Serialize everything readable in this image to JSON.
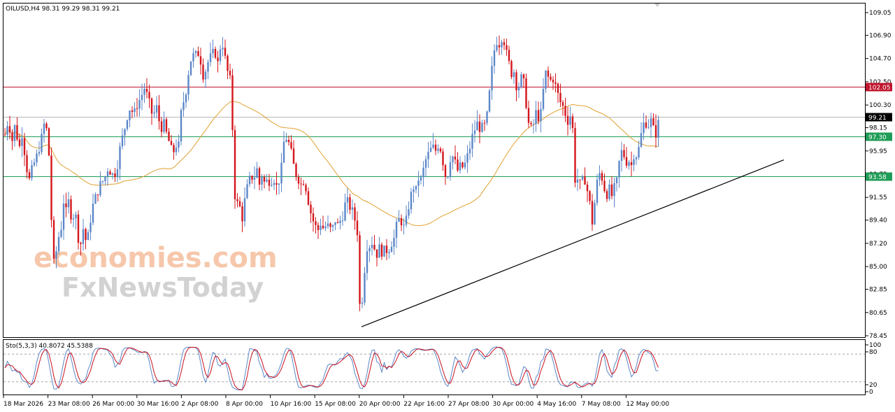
{
  "chart_data": {
    "type": "candlestick",
    "header": "OILUSD,H4  98.31 99.29 98.31 99.21",
    "oscillator_label": "Sto(5,3,3) 40.8072 45.5388",
    "price_ticks": [
      "109.05",
      "106.90",
      "104.70",
      "102.50",
      "100.30",
      "98.15",
      "95.95",
      "93.75",
      "91.55",
      "89.40",
      "87.20",
      "85.00",
      "82.85",
      "80.65",
      "78.45"
    ],
    "price_range": [
      78.45,
      109.05
    ],
    "oscillator_ticks": [
      "100",
      "80",
      "20",
      "0"
    ],
    "oscillator_levels": [
      80,
      20
    ],
    "time_labels": [
      "18 Mar 2026",
      "23 Mar 08:00",
      "26 Mar 00:00",
      "30 Mar 16:00",
      "2 Apr 08:00",
      "8 Apr 00:00",
      "10 Apr 16:00",
      "15 Apr 08:00",
      "20 Apr 00:00",
      "22 Apr 16:00",
      "27 Apr 08:00",
      "30 Apr 00:00",
      "4 May 16:00",
      "7 May 08:00",
      "12 May 00:00"
    ],
    "levels": [
      {
        "value": 102.05,
        "label": "102.05",
        "color": "#c0142c"
      },
      {
        "value": 99.21,
        "label": "99.21",
        "color": "#000000"
      },
      {
        "value": 97.3,
        "label": "97.30",
        "color": "#1f9c57"
      },
      {
        "value": 93.58,
        "label": "93.58",
        "color": "#1f9c57"
      }
    ],
    "trendline": {
      "from": [
        110,
        79.3
      ],
      "to": [
        1080,
        95.1
      ],
      "color": "#000000"
    },
    "close_path": [
      [
        0,
        97.5
      ],
      [
        5,
        99.0
      ],
      [
        10,
        96.8
      ],
      [
        15,
        98.6
      ],
      [
        20,
        96.0
      ],
      [
        25,
        97.8
      ],
      [
        30,
        94.7
      ],
      [
        35,
        93.2
      ],
      [
        40,
        94.5
      ],
      [
        45,
        95.3
      ],
      [
        52,
        97.0
      ],
      [
        57,
        98.8
      ],
      [
        62,
        97.1
      ],
      [
        65,
        92.5
      ],
      [
        68,
        86.5
      ],
      [
        71,
        84.7
      ],
      [
        75,
        87.5
      ],
      [
        80,
        88.4
      ],
      [
        84,
        91.2
      ],
      [
        88,
        90.0
      ],
      [
        92,
        91.5
      ],
      [
        96,
        89.0
      ],
      [
        100,
        90.7
      ],
      [
        104,
        88.0
      ],
      [
        108,
        87.0
      ],
      [
        112,
        88.6
      ],
      [
        116,
        87.4
      ],
      [
        120,
        88.0
      ],
      [
        124,
        90.4
      ],
      [
        128,
        91.2
      ],
      [
        132,
        92.0
      ],
      [
        136,
        92.7
      ],
      [
        140,
        93.1
      ],
      [
        144,
        93.6
      ],
      [
        148,
        94.5
      ],
      [
        152,
        93.8
      ],
      [
        156,
        93.6
      ],
      [
        160,
        94.3
      ],
      [
        164,
        96.0
      ],
      [
        168,
        97.2
      ],
      [
        172,
        98.3
      ],
      [
        176,
        99.6
      ],
      [
        180,
        100.2
      ],
      [
        184,
        99.2
      ],
      [
        188,
        100.2
      ],
      [
        192,
        100.7
      ],
      [
        196,
        101.3
      ],
      [
        200,
        102.0
      ],
      [
        204,
        101.0
      ],
      [
        208,
        100.1
      ],
      [
        212,
        99.0
      ],
      [
        216,
        100.4
      ],
      [
        220,
        98.9
      ],
      [
        224,
        98.2
      ],
      [
        228,
        98.5
      ],
      [
        232,
        97.3
      ],
      [
        236,
        96.6
      ],
      [
        240,
        95.5
      ],
      [
        244,
        96.7
      ],
      [
        248,
        96.0
      ],
      [
        252,
        99.5
      ],
      [
        256,
        100.8
      ],
      [
        260,
        102.0
      ],
      [
        264,
        104.2
      ],
      [
        268,
        105.0
      ],
      [
        272,
        104.9
      ],
      [
        276,
        105.3
      ],
      [
        280,
        104.5
      ],
      [
        284,
        103.0
      ],
      [
        288,
        103.8
      ],
      [
        292,
        104.7
      ],
      [
        296,
        104.9
      ],
      [
        300,
        105.6
      ],
      [
        304,
        104.0
      ],
      [
        308,
        105.8
      ],
      [
        312,
        106.1
      ],
      [
        316,
        104.2
      ],
      [
        320,
        103.0
      ],
      [
        324,
        102.3
      ],
      [
        326,
        96.7
      ],
      [
        328,
        92.0
      ],
      [
        332,
        91.0
      ],
      [
        336,
        90.6
      ],
      [
        340,
        89.5
      ],
      [
        344,
        91.8
      ],
      [
        348,
        92.8
      ],
      [
        352,
        93.6
      ],
      [
        356,
        93.3
      ],
      [
        360,
        94.4
      ],
      [
        364,
        92.8
      ],
      [
        368,
        93.8
      ],
      [
        372,
        92.7
      ],
      [
        376,
        93.3
      ],
      [
        380,
        93.0
      ],
      [
        384,
        93.6
      ],
      [
        388,
        92.5
      ],
      [
        392,
        93.2
      ],
      [
        396,
        94.5
      ],
      [
        400,
        97.5
      ],
      [
        404,
        97.0
      ],
      [
        408,
        96.3
      ],
      [
        412,
        94.8
      ],
      [
        416,
        93.8
      ],
      [
        420,
        93.3
      ],
      [
        424,
        92.7
      ],
      [
        428,
        93.3
      ],
      [
        432,
        92.0
      ],
      [
        436,
        90.5
      ],
      [
        440,
        89.5
      ],
      [
        444,
        88.8
      ],
      [
        448,
        88.5
      ],
      [
        452,
        89.2
      ],
      [
        456,
        88.5
      ],
      [
        460,
        89.0
      ],
      [
        464,
        88.6
      ],
      [
        468,
        88.4
      ],
      [
        472,
        89.5
      ],
      [
        476,
        88.9
      ],
      [
        480,
        89.4
      ],
      [
        484,
        90.0
      ],
      [
        488,
        91.4
      ],
      [
        492,
        90.8
      ],
      [
        496,
        90.4
      ],
      [
        500,
        89.6
      ],
      [
        504,
        88.3
      ],
      [
        507,
        81.3
      ],
      [
        510,
        81.8
      ],
      [
        513,
        82.4
      ],
      [
        516,
        87.2
      ],
      [
        520,
        86.7
      ],
      [
        524,
        87.5
      ],
      [
        528,
        86.8
      ],
      [
        532,
        86.2
      ],
      [
        536,
        86.8
      ],
      [
        540,
        86.3
      ],
      [
        544,
        86.6
      ],
      [
        548,
        86.5
      ],
      [
        552,
        87.2
      ],
      [
        556,
        87.5
      ],
      [
        560,
        88.8
      ],
      [
        564,
        89.5
      ],
      [
        568,
        89.2
      ],
      [
        572,
        88.4
      ],
      [
        576,
        90.3
      ],
      [
        580,
        91.5
      ],
      [
        584,
        92.6
      ],
      [
        588,
        92.2
      ],
      [
        592,
        93.5
      ],
      [
        596,
        93.1
      ],
      [
        600,
        94.8
      ],
      [
        604,
        95.4
      ],
      [
        608,
        96.0
      ],
      [
        612,
        96.3
      ],
      [
        616,
        96.0
      ],
      [
        620,
        96.6
      ],
      [
        624,
        96.0
      ],
      [
        628,
        94.3
      ],
      [
        632,
        93.0
      ],
      [
        636,
        95.2
      ],
      [
        640,
        95.5
      ],
      [
        644,
        94.8
      ],
      [
        648,
        94.0
      ],
      [
        652,
        94.6
      ],
      [
        656,
        94.3
      ],
      [
        660,
        95.1
      ],
      [
        664,
        96.0
      ],
      [
        668,
        97.2
      ],
      [
        672,
        98.0
      ],
      [
        676,
        98.6
      ],
      [
        680,
        98.0
      ],
      [
        684,
        98.2
      ],
      [
        688,
        98.4
      ],
      [
        692,
        100.7
      ],
      [
        696,
        103.4
      ],
      [
        700,
        105.5
      ],
      [
        704,
        106.5
      ],
      [
        708,
        106.0
      ],
      [
        712,
        107.2
      ],
      [
        716,
        105.5
      ],
      [
        720,
        104.5
      ],
      [
        724,
        103.3
      ],
      [
        728,
        103.5
      ],
      [
        732,
        102.0
      ],
      [
        736,
        102.2
      ],
      [
        740,
        103.2
      ],
      [
        744,
        101.5
      ],
      [
        748,
        98.7
      ],
      [
        752,
        98.0
      ],
      [
        756,
        98.5
      ],
      [
        760,
        99.7
      ],
      [
        764,
        99.0
      ],
      [
        768,
        99.8
      ],
      [
        772,
        103.5
      ],
      [
        776,
        103.0
      ],
      [
        780,
        102.6
      ],
      [
        784,
        102.8
      ],
      [
        788,
        102.0
      ],
      [
        792,
        101.0
      ],
      [
        796,
        100.3
      ],
      [
        800,
        100.0
      ],
      [
        804,
        98.6
      ],
      [
        808,
        99.5
      ],
      [
        812,
        98.0
      ],
      [
        816,
        92.6
      ],
      [
        820,
        93.5
      ],
      [
        824,
        92.4
      ],
      [
        828,
        93.7
      ],
      [
        832,
        92.5
      ],
      [
        836,
        91.2
      ],
      [
        840,
        89.2
      ],
      [
        844,
        91.3
      ],
      [
        848,
        93.5
      ],
      [
        852,
        94.0
      ],
      [
        856,
        92.8
      ],
      [
        860,
        91.7
      ],
      [
        864,
        92.4
      ],
      [
        868,
        91.7
      ],
      [
        872,
        92.5
      ],
      [
        876,
        93.2
      ],
      [
        880,
        95.8
      ],
      [
        884,
        95.9
      ],
      [
        888,
        94.9
      ],
      [
        892,
        95.1
      ],
      [
        896,
        94.6
      ],
      [
        900,
        95.8
      ],
      [
        904,
        95.5
      ],
      [
        908,
        96.6
      ],
      [
        912,
        98.4
      ],
      [
        916,
        98.7
      ],
      [
        920,
        98.4
      ],
      [
        924,
        98.8
      ],
      [
        928,
        97.9
      ],
      [
        932,
        97.5
      ],
      [
        936,
        99.2
      ]
    ]
  },
  "watermark": {
    "line1": "economies.com",
    "line2": "FxNewsToday"
  },
  "colors": {
    "bull": "#5b87c8",
    "bear": "#d4151b",
    "ma": "#e0a030",
    "stoch_main": "#5b87c8",
    "stoch_signal": "#c8101e"
  }
}
